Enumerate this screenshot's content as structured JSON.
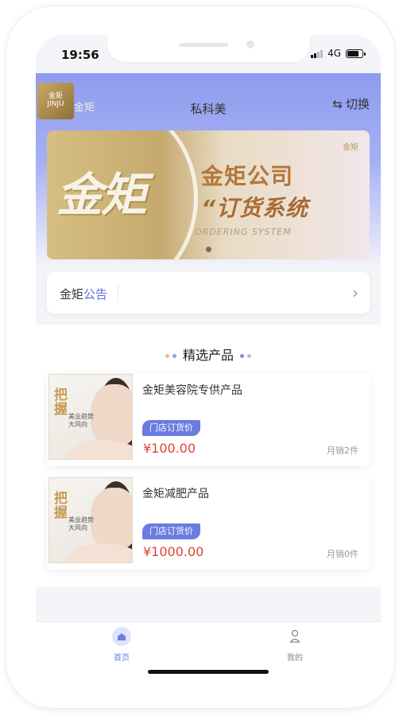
{
  "status": {
    "time": "19:56",
    "network": "4G"
  },
  "header": {
    "logo_text": "金矩",
    "title": "私科美",
    "switch_label": "切换",
    "switch_icon": "swap-icon"
  },
  "banner": {
    "big_text": "金矩",
    "company": "金矩公司",
    "system": "“订货系统",
    "english": "ORDERING SYSTEM",
    "slide_count": 1
  },
  "notice": {
    "prefix": "金矩",
    "highlight": "公告",
    "arrow_icon": "chevron-right-icon"
  },
  "products_section": {
    "title": "精选产品",
    "items": [
      {
        "name": "金矩美容院专供产品",
        "tag": "门店订货价",
        "price": "¥100.00",
        "sales": "月销2件",
        "thumb_text_1": "把",
        "thumb_text_2": "握",
        "thumb_sub_1": "美业趋势",
        "thumb_sub_2": "大风向"
      },
      {
        "name": "金矩减肥产品",
        "tag": "门店订货价",
        "price": "¥1000.00",
        "sales": "月销0件",
        "thumb_text_1": "把",
        "thumb_text_2": "握",
        "thumb_sub_1": "美业趋势",
        "thumb_sub_2": "大风向"
      }
    ]
  },
  "tabbar": {
    "items": [
      {
        "label": "首页",
        "icon": "home-icon",
        "active": true
      },
      {
        "label": "我的",
        "icon": "user-icon",
        "active": false
      }
    ]
  },
  "colors": {
    "accent": "#6b7be0",
    "price": "#e0452f",
    "header_gradient_top": "#8e9bef"
  }
}
